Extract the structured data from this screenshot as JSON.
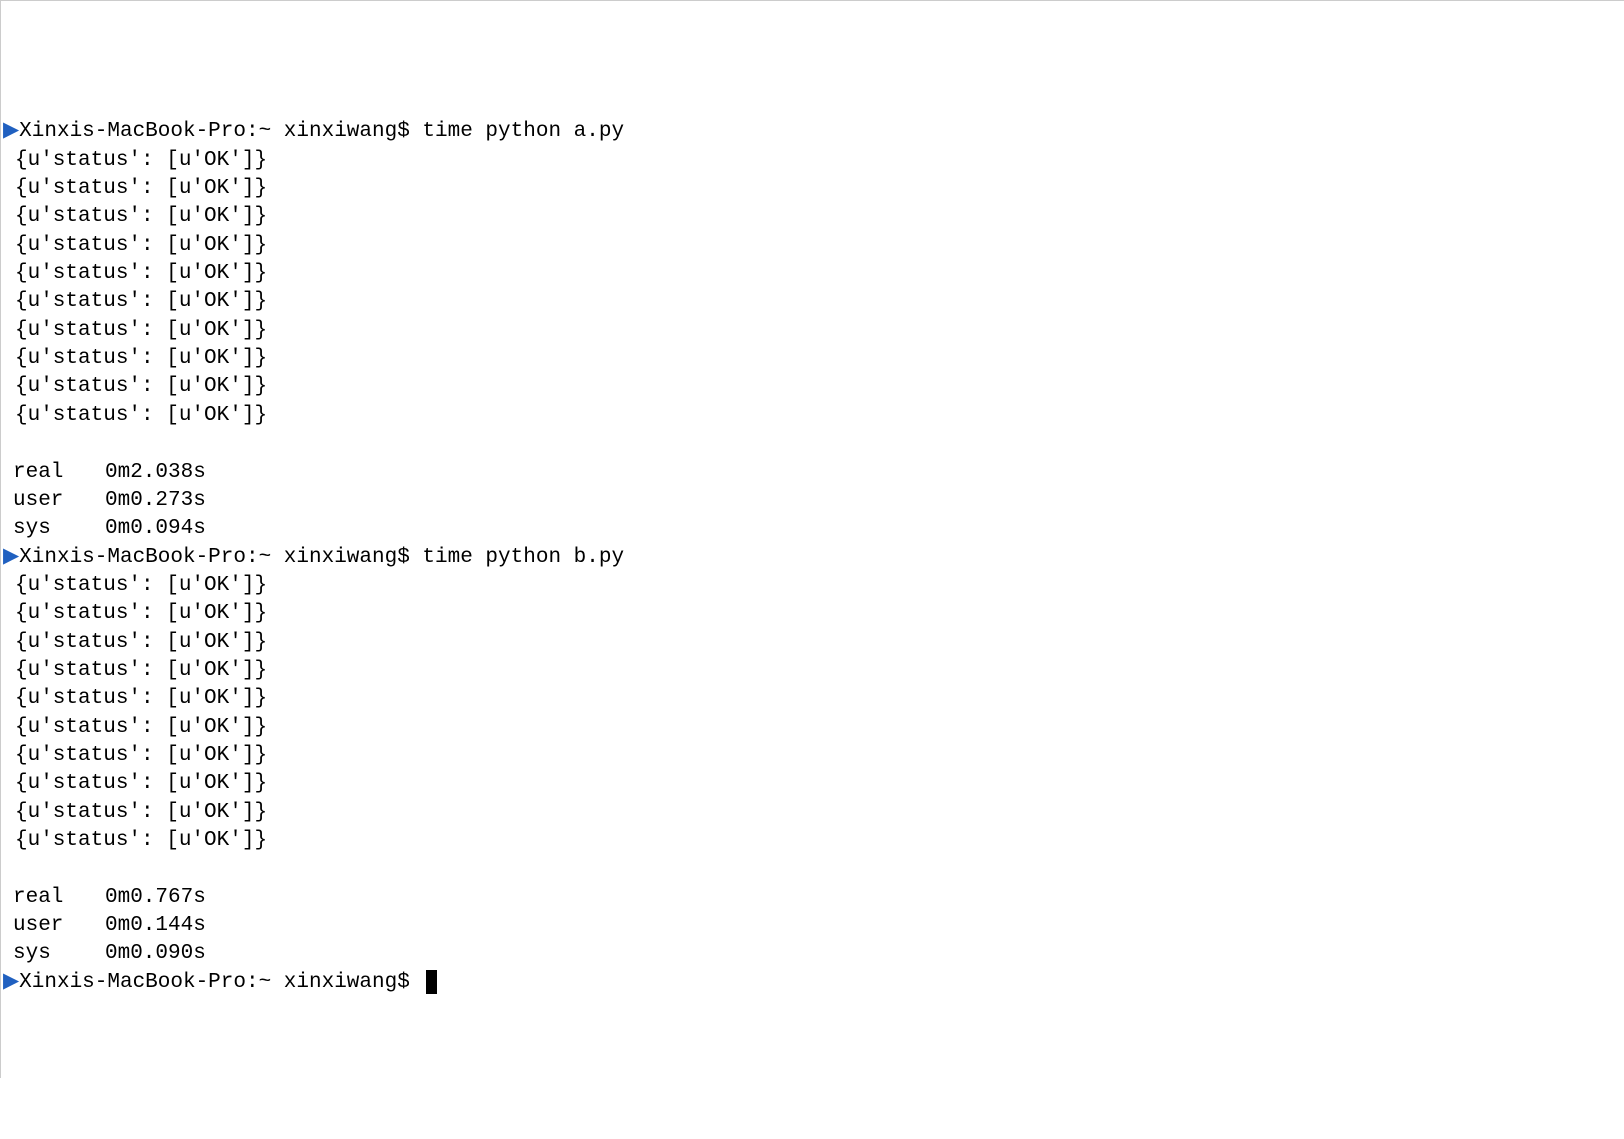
{
  "blocks": [
    {
      "prompt": {
        "marker": "▶",
        "host": "Xinxis-MacBook-Pro:~",
        "user": "xinxiwang$",
        "command": "time python a.py"
      },
      "output_lines": [
        "{u'status': [u'OK']}",
        "{u'status': [u'OK']}",
        "{u'status': [u'OK']}",
        "{u'status': [u'OK']}",
        "{u'status': [u'OK']}",
        "{u'status': [u'OK']}",
        "{u'status': [u'OK']}",
        "{u'status': [u'OK']}",
        "{u'status': [u'OK']}",
        "{u'status': [u'OK']}"
      ],
      "timing": [
        {
          "label": "real",
          "value": "0m2.038s"
        },
        {
          "label": "user",
          "value": "0m0.273s"
        },
        {
          "label": "sys",
          "value": "0m0.094s"
        }
      ]
    },
    {
      "prompt": {
        "marker": "▶",
        "host": "Xinxis-MacBook-Pro:~",
        "user": "xinxiwang$",
        "command": "time python b.py"
      },
      "output_lines": [
        "{u'status': [u'OK']}",
        "{u'status': [u'OK']}",
        "{u'status': [u'OK']}",
        "{u'status': [u'OK']}",
        "{u'status': [u'OK']}",
        "{u'status': [u'OK']}",
        "{u'status': [u'OK']}",
        "{u'status': [u'OK']}",
        "{u'status': [u'OK']}",
        "{u'status': [u'OK']}"
      ],
      "timing": [
        {
          "label": "real",
          "value": "0m0.767s"
        },
        {
          "label": "user",
          "value": "0m0.144s"
        },
        {
          "label": "sys",
          "value": "0m0.090s"
        }
      ]
    }
  ],
  "final_prompt": {
    "marker": "▶",
    "host": "Xinxis-MacBook-Pro:~",
    "user": "xinxiwang$"
  }
}
